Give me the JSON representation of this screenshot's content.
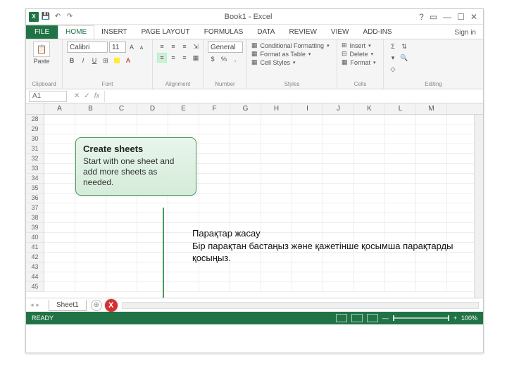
{
  "titlebar": {
    "title": "Book1 - Excel"
  },
  "win": {
    "help": "?",
    "ribbon_toggle": "▭",
    "min": "—",
    "max": "☐",
    "close": "✕"
  },
  "tabs": {
    "file": "FILE",
    "items": [
      "HOME",
      "INSERT",
      "PAGE LAYOUT",
      "FORMULAS",
      "DATA",
      "REVIEW",
      "VIEW",
      "ADD-INS"
    ],
    "active_index": 0,
    "signin": "Sign in"
  },
  "ribbon": {
    "clipboard": {
      "paste": "Paste",
      "label": "Clipboard"
    },
    "font": {
      "name": "Calibri",
      "size": "11",
      "label": "Font",
      "buttons": {
        "bold": "B",
        "italic": "I",
        "underline": "U",
        "border": "⊞",
        "fill": "▦",
        "color": "A"
      }
    },
    "alignment": {
      "label": "Alignment"
    },
    "number": {
      "format": "General",
      "label": "Number"
    },
    "styles": {
      "cond": "Conditional Formatting",
      "table": "Format as Table",
      "cell": "Cell Styles",
      "label": "Styles"
    },
    "cells": {
      "insert": "Insert",
      "delete": "Delete",
      "format": "Format",
      "label": "Cells"
    },
    "editing": {
      "label": "Editing"
    }
  },
  "fx": {
    "namebox": "A1",
    "fx_symbol": "fx"
  },
  "grid": {
    "columns": [
      "A",
      "B",
      "C",
      "D",
      "E",
      "F",
      "G",
      "H",
      "I",
      "J",
      "K",
      "L",
      "M"
    ],
    "rows": [
      28,
      29,
      30,
      31,
      32,
      33,
      34,
      35,
      36,
      37,
      38,
      39,
      40,
      41,
      42,
      43,
      44,
      45
    ]
  },
  "callout": {
    "title": "Create sheets",
    "body": "Start with one sheet and add more sheets as needed."
  },
  "translated": {
    "title": "Парақтар жасау",
    "body": "Бір парақтан бастаңыз және қажетінше қосымша парақтарды қосыңыз."
  },
  "sheets": {
    "tab": "Sheet1",
    "new": "+"
  },
  "status": {
    "ready": "READY",
    "zoom": "100%",
    "plus": "+",
    "minus": "—"
  },
  "x_badge": "X"
}
